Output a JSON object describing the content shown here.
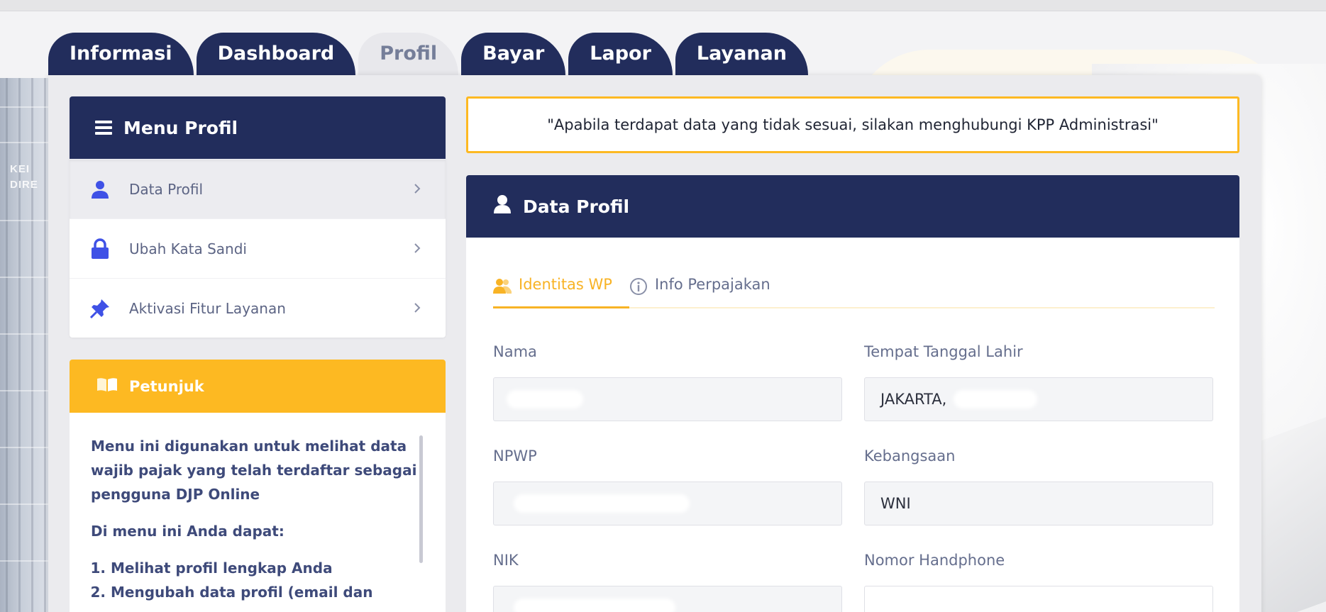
{
  "tabs": [
    {
      "label": "Informasi",
      "active": false
    },
    {
      "label": "Dashboard",
      "active": false
    },
    {
      "label": "Profil",
      "active": true
    },
    {
      "label": "Bayar",
      "active": false
    },
    {
      "label": "Lapor",
      "active": false
    },
    {
      "label": "Layanan",
      "active": false
    }
  ],
  "background": {
    "sign_text": [
      "KEI",
      "DIRE"
    ]
  },
  "menu": {
    "title": "Menu Profil",
    "items": [
      {
        "label": "Data Profil",
        "icon": "user-icon",
        "active": true
      },
      {
        "label": "Ubah Kata Sandi",
        "icon": "lock-icon",
        "active": false
      },
      {
        "label": "Aktivasi Fitur Layanan",
        "icon": "pin-icon",
        "active": false
      }
    ]
  },
  "petunjuk": {
    "title": "Petunjuk",
    "intro": "Menu ini digunakan untuk melihat data wajib pajak yang telah terdaftar sebagai pengguna DJP Online",
    "subheading": "Di menu ini Anda dapat:",
    "steps": [
      "Melihat profil lengkap Anda",
      "Mengubah data profil (email dan"
    ]
  },
  "notice": "\"Apabila terdapat data yang tidak sesuai, silakan menghubungi KPP Administrasi\"",
  "profile": {
    "title": "Data Profil",
    "subtabs": [
      {
        "label": "Identitas WP",
        "icon": "users-icon",
        "active": true
      },
      {
        "label": "Info Perpajakan",
        "icon": "info-icon",
        "active": false
      }
    ],
    "fields": {
      "nama": {
        "label": "Nama",
        "value": ""
      },
      "ttl": {
        "label": "Tempat Tanggal Lahir",
        "value": "JAKARTA,"
      },
      "npwp": {
        "label": "NPWP",
        "value": ""
      },
      "kebangsaan": {
        "label": "Kebangsaan",
        "value": "WNI"
      },
      "nik": {
        "label": "NIK",
        "value": ""
      },
      "hp": {
        "label": "Nomor Handphone",
        "value": ""
      }
    }
  },
  "colors": {
    "navy": "#222d5c",
    "accent": "#fdb922",
    "icon_blue": "#3f51e6"
  }
}
